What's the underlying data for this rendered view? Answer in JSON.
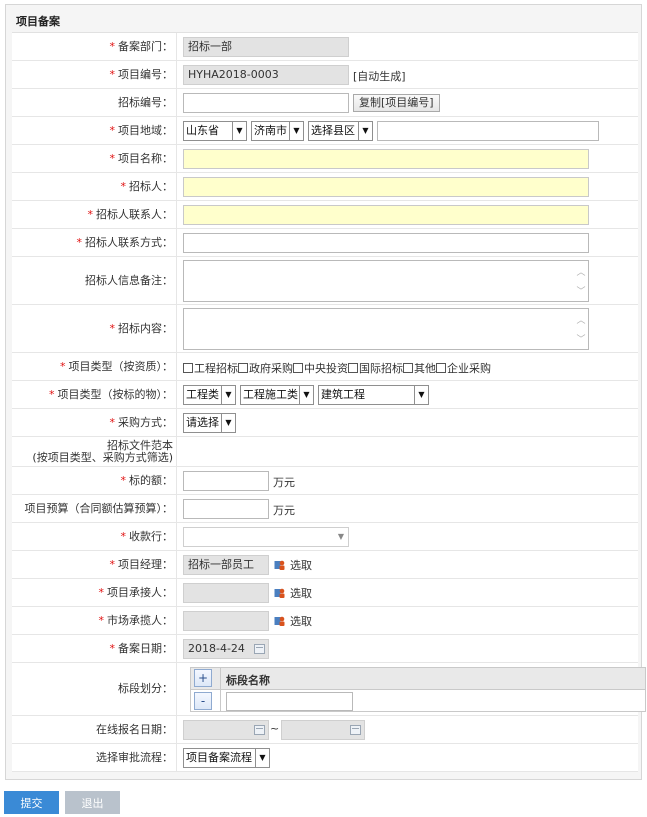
{
  "panel": {
    "title": "项目备案"
  },
  "colors": {
    "required": "#e01010",
    "highlight_input": "#ffffcc",
    "readonly_input": "#e3e3e3",
    "submit_button": "#3a8ad6",
    "exit_button": "#b9c2cc"
  },
  "form": {
    "dept": {
      "label": "备案部门：",
      "value": "招标一部"
    },
    "project_no": {
      "label": "项目编号：",
      "value": "HYHA2018-0003",
      "note": "[自动生成]"
    },
    "tender_no": {
      "label": "招标编号：",
      "value": "",
      "copy_label": "复制[项目编号]"
    },
    "region": {
      "label": "项目地域：",
      "province": "山东省",
      "city": "济南市",
      "county": "选择县区",
      "detail": ""
    },
    "project_name": {
      "label": "项目名称：",
      "value": ""
    },
    "tenderer": {
      "label": "招标人：",
      "value": ""
    },
    "tenderer_contact": {
      "label": "招标人联系人：",
      "value": ""
    },
    "tenderer_phone": {
      "label": "招标人联系方式：",
      "value": ""
    },
    "tenderer_note": {
      "label": "招标人信息备注：",
      "value": ""
    },
    "tender_content": {
      "label": "招标内容：",
      "value": ""
    },
    "type_qualification": {
      "label": "项目类型（按资质）：",
      "options": [
        "工程招标",
        "政府采购",
        "中央投资",
        "国际招标",
        "其他",
        "企业采购"
      ]
    },
    "type_subject": {
      "label": "项目类型（按标的物）：",
      "level1": "工程类",
      "level2": "工程施工类",
      "level3": "建筑工程"
    },
    "purchase_method": {
      "label": "采购方式：",
      "value": "请选择"
    },
    "template": {
      "label_line1": "招标文件范本",
      "label_line2": "(按项目类型、采购方式筛选)"
    },
    "amount": {
      "label": "标的额：",
      "value": "",
      "unit": "万元"
    },
    "budget": {
      "label": "项目预算（合同额估算预算）：",
      "value": "",
      "unit": "万元"
    },
    "bank": {
      "label": "收款行：",
      "value": ""
    },
    "manager": {
      "label": "项目经理：",
      "value": "招标一部员工",
      "pick": "选取"
    },
    "undertaker": {
      "label": "项目承接人：",
      "value": "",
      "pick": "选取"
    },
    "marketer": {
      "label": "市场承揽人：",
      "value": "",
      "pick": "选取"
    },
    "record_date": {
      "label": "备案日期：",
      "value": "2018-4-24"
    },
    "sections": {
      "label": "标段划分：",
      "add": "+",
      "remove": "-",
      "column": "标段名称",
      "value": ""
    },
    "signup_date": {
      "label": "在线报名日期：",
      "from": "",
      "to": "",
      "sep": "~"
    },
    "flow": {
      "label": "选择审批流程：",
      "value": "项目备案流程"
    }
  },
  "buttons": {
    "submit": "提交",
    "exit": "退出"
  },
  "icons": {
    "select_arrow": "chevron-down-icon",
    "picker": "person-picker-icon",
    "calendar": "calendar-icon"
  }
}
